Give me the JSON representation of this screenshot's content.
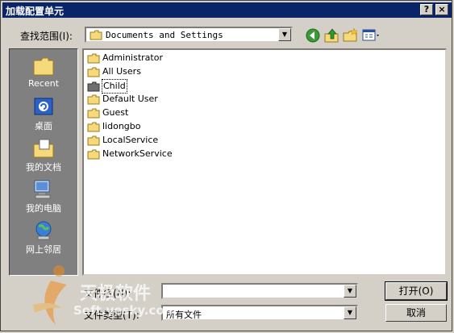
{
  "window": {
    "title": "加载配置单元"
  },
  "titlebar_buttons": {
    "help": "?",
    "close": "×"
  },
  "lookin": {
    "label": "查找范围(I):",
    "value": "Documents and Settings"
  },
  "places": [
    {
      "label": "Recent",
      "icon": "recent-folder-icon"
    },
    {
      "label": "桌面",
      "icon": "desktop-icon"
    },
    {
      "label": "我的文档",
      "icon": "my-documents-icon"
    },
    {
      "label": "我的电脑",
      "icon": "my-computer-icon"
    },
    {
      "label": "网上邻居",
      "icon": "network-icon"
    }
  ],
  "files": [
    {
      "name": "Administrator"
    },
    {
      "name": "All Users"
    },
    {
      "name": "Child"
    },
    {
      "name": "Default User"
    },
    {
      "name": "Guest"
    },
    {
      "name": "lidongbo"
    },
    {
      "name": "LocalService"
    },
    {
      "name": "NetworkService"
    }
  ],
  "selected_file": "Child",
  "filename": {
    "label": "文件名(N):",
    "value": ""
  },
  "filetype": {
    "label": "文件类型(T):",
    "value": "所有文件"
  },
  "buttons": {
    "open": "打开(O)",
    "cancel": "取消"
  },
  "watermark": {
    "brand": "天极软件",
    "site": "Soft.yesky.com"
  },
  "colors": {
    "titlebar": "#0a246a",
    "face": "#d4d0c8",
    "places_bg": "#808080"
  }
}
